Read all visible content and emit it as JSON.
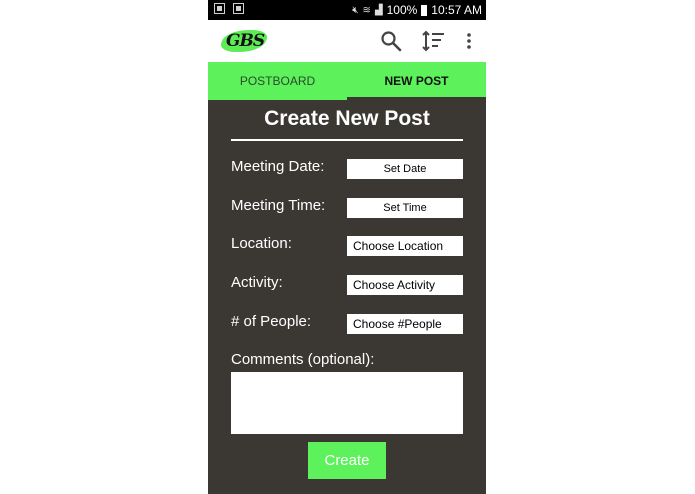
{
  "status_bar": {
    "battery": "100%",
    "time": "10:57 AM"
  },
  "app_bar": {
    "logo_text": "GBS",
    "icons": [
      "search-icon",
      "sort-icon",
      "more-vert-icon"
    ]
  },
  "tabs": [
    {
      "label": "POSTBOARD",
      "active": false
    },
    {
      "label": "NEW POST",
      "active": true
    }
  ],
  "form": {
    "title": "Create New Post",
    "meeting_date": {
      "label": "Meeting Date:",
      "button": "Set Date"
    },
    "meeting_time": {
      "label": "Meeting Time:",
      "button": "Set Time"
    },
    "location": {
      "label": "Location:",
      "value": "Choose Location"
    },
    "activity": {
      "label": "Activity:",
      "value": "Choose Activity"
    },
    "people": {
      "label": "# of People:",
      "value": "Choose #People"
    },
    "comments": {
      "label": "Comments (optional):",
      "value": ""
    },
    "submit_label": "Create"
  },
  "colors": {
    "accent_green": "#5df15c",
    "background": "#3b3834",
    "text": "#ffffff"
  }
}
